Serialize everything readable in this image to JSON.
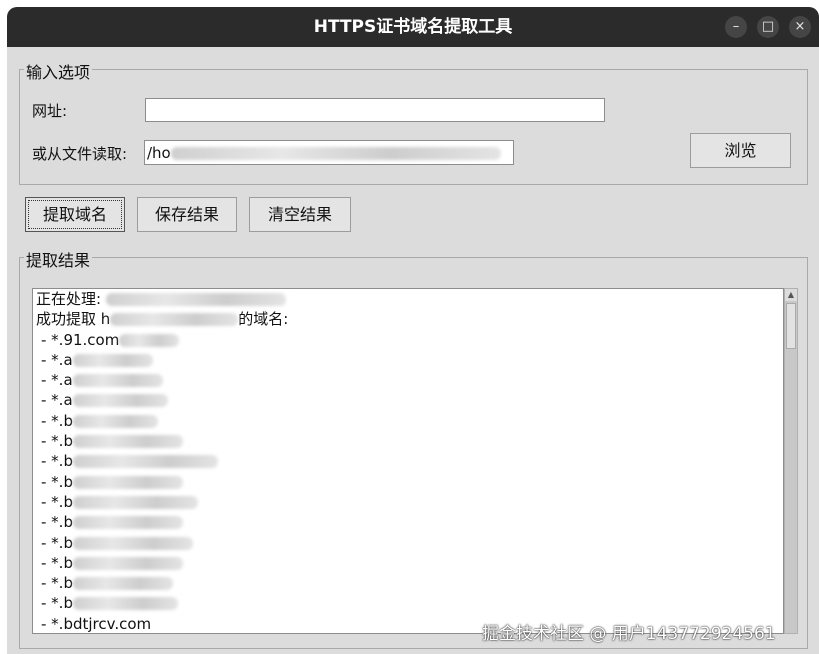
{
  "window": {
    "title": "HTTPS证书域名提取工具",
    "controls": {
      "minimize": "–",
      "maximize": "□",
      "close": "×"
    }
  },
  "input_group": {
    "legend": "输入选项",
    "url_label": "网址:",
    "url_value": "",
    "file_label": "或从文件读取:",
    "file_value_visible": "/ho",
    "browse_label": "浏览"
  },
  "actions": {
    "extract_label": "提取域名",
    "save_label": "保存结果",
    "clear_label": "清空结果"
  },
  "results_group": {
    "legend": "提取结果",
    "processing_prefix": "正在处理: ",
    "success_prefix": "成功提取 h",
    "success_suffix": "的域名:",
    "domains_visible": [
      "- *.91.com",
      "- *.a",
      "- *.a",
      "- *.a",
      "- *.b",
      "- *.b",
      "- *.b",
      "- *.b",
      "- *.b",
      "- *.b",
      "- *.b",
      "- *.b",
      "- *.b",
      "- *.b",
      "- *.bdtjrcv.com"
    ]
  },
  "watermark": "掘金技术社区 @ 用户143772924561"
}
